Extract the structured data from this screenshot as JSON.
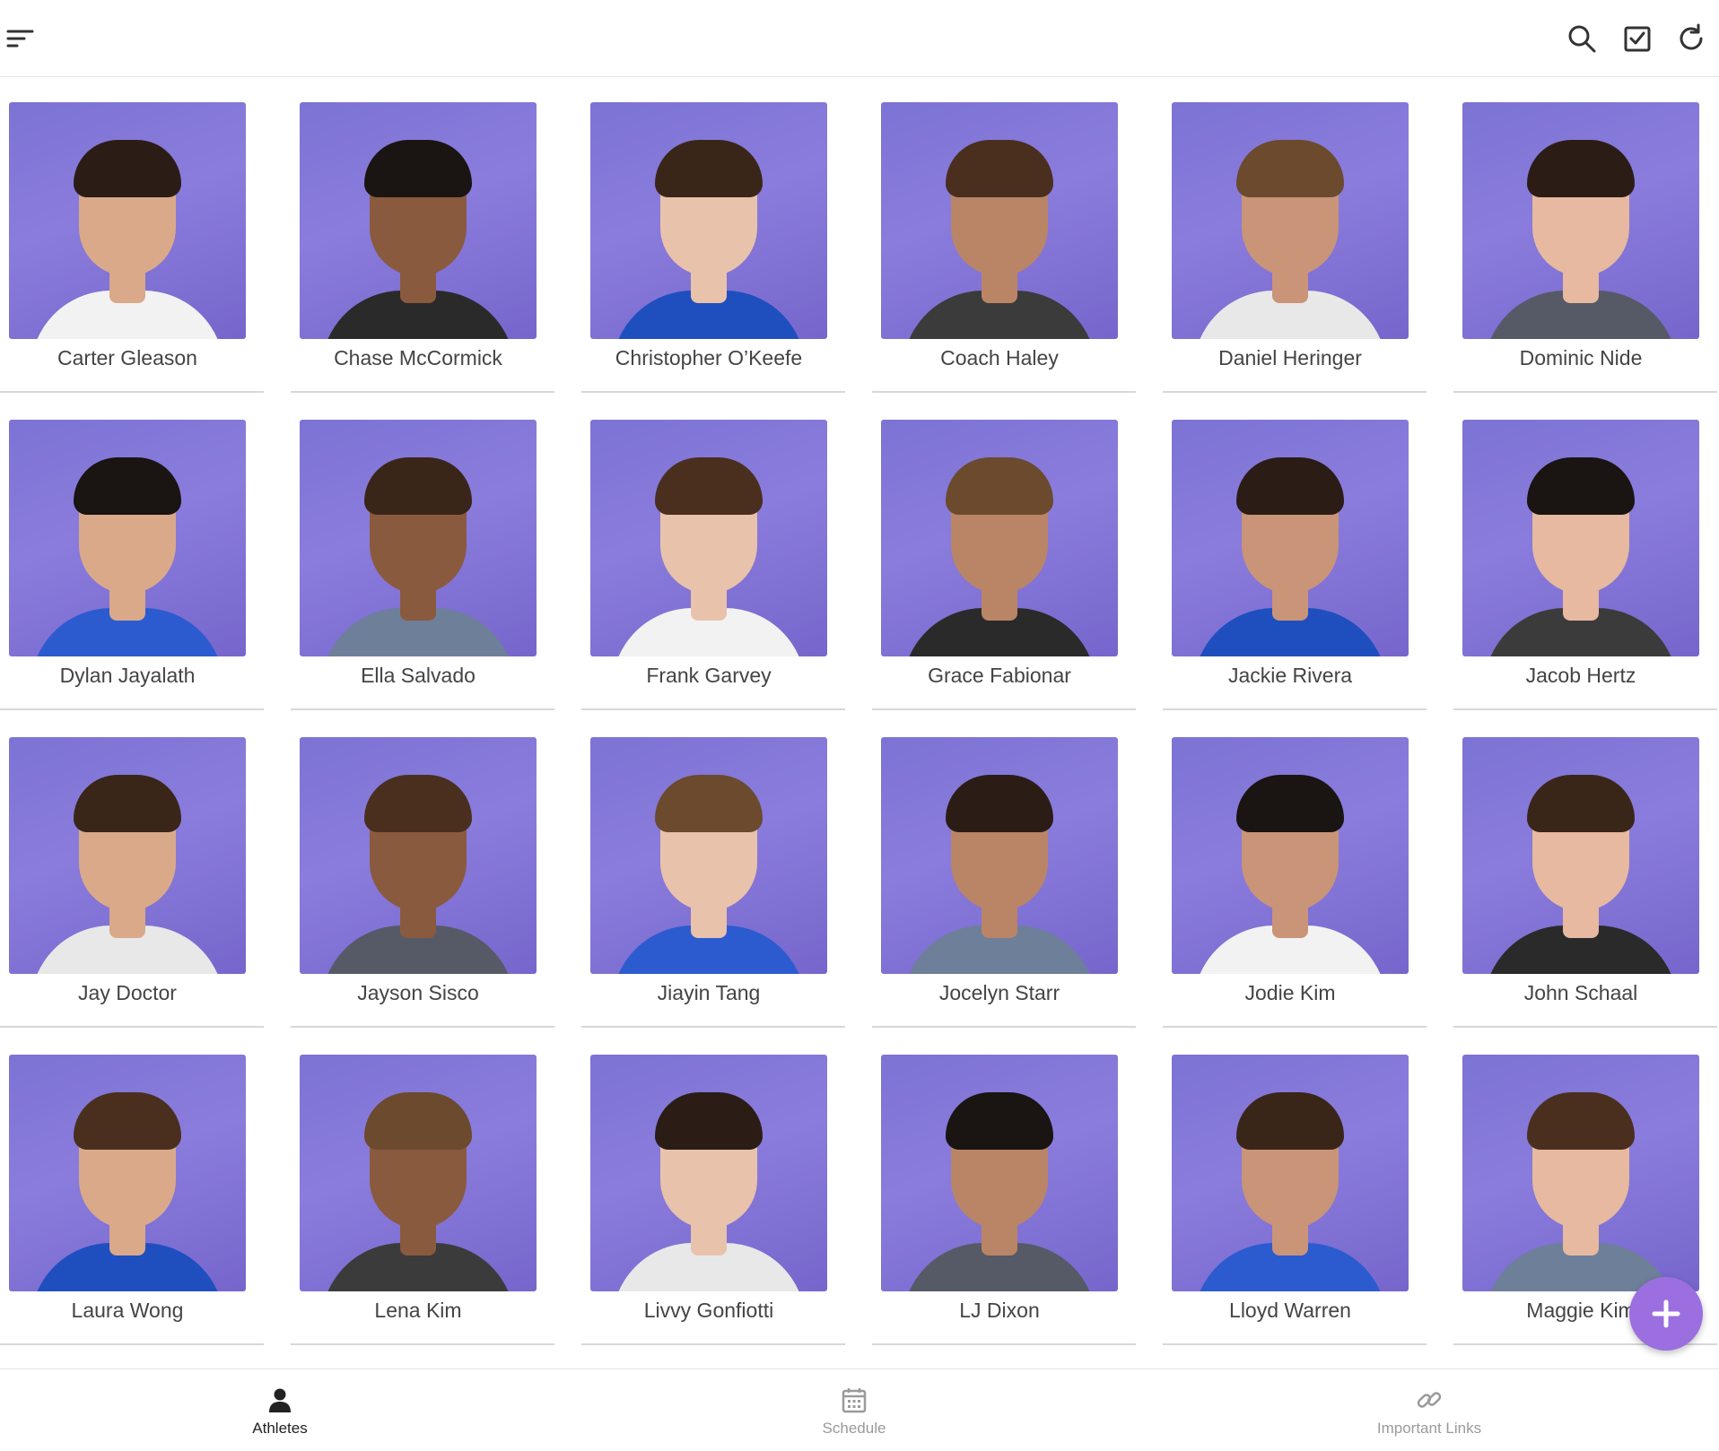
{
  "toolbar": {
    "menu_icon": "sort-lines-icon",
    "actions": [
      "search-icon",
      "checkbox-icon",
      "refresh-icon"
    ]
  },
  "athletes": [
    "Carter Gleason",
    "Chase McCormick",
    "Christopher O’Keefe",
    "Coach Haley",
    "Daniel Heringer",
    "Dominic Nide",
    "Dylan Jayalath",
    "Ella Salvado",
    "Frank Garvey",
    "Grace Fabionar",
    "Jackie Rivera",
    "Jacob Hertz",
    "Jay Doctor",
    "Jayson Sisco",
    "Jiayin Tang",
    "Jocelyn Starr",
    "Jodie Kim",
    "John Schaal",
    "Laura Wong",
    "Lena Kim",
    "Livvy Gonfiotti",
    "LJ Dixon",
    "Lloyd Warren",
    "Maggie Kim"
  ],
  "fab": {
    "icon": "plus-icon"
  },
  "bottom_tabs": [
    {
      "label": "Athletes",
      "icon": "person-icon",
      "active": true
    },
    {
      "label": "Schedule",
      "icon": "calendar-icon",
      "active": false
    },
    {
      "label": "Important Links",
      "icon": "link-icon",
      "active": false
    }
  ],
  "colors": {
    "photo_background": "#8478d6",
    "accent": "#9c6fe0",
    "active_tab": "#222222",
    "inactive_tab": "#9a9a9a"
  }
}
